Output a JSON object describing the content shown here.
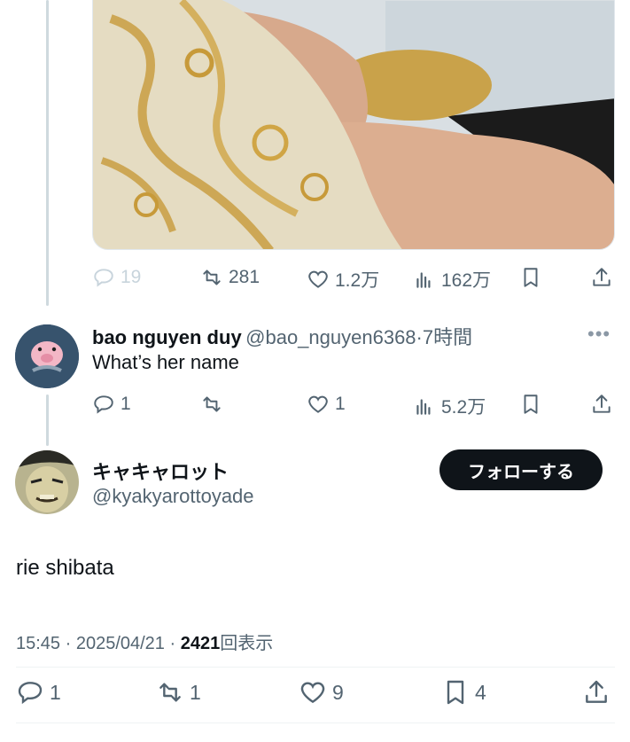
{
  "original_tweet": {
    "actions": {
      "replies": "19",
      "retweets": "281",
      "likes": "1.2万",
      "views": "162万"
    }
  },
  "reply": {
    "display_name": "bao nguyen duy",
    "handle": "@bao_nguyen6368",
    "separator": "·",
    "time": "7時間",
    "text": "What’s her name",
    "more_icon": "more-horizontal-icon",
    "actions": {
      "replies": "1",
      "retweets": "",
      "likes": "1",
      "views": "5.2万"
    }
  },
  "main_tweet": {
    "display_name": "キャキャロット",
    "handle": "@kyakyarottoyade",
    "follow_label": "フォローする",
    "text": "rie shibata",
    "timestamp": "15:45 · 2025/04/21 · ",
    "view_count": "2421",
    "view_suffix": "回表示",
    "actions": {
      "replies": "1",
      "retweets": "1",
      "likes": "9",
      "bookmarks": "4"
    }
  },
  "colors": {
    "text": "#0f1419",
    "secondary": "#536471",
    "thread_line": "#cfd9de",
    "button": "#0f1419"
  }
}
